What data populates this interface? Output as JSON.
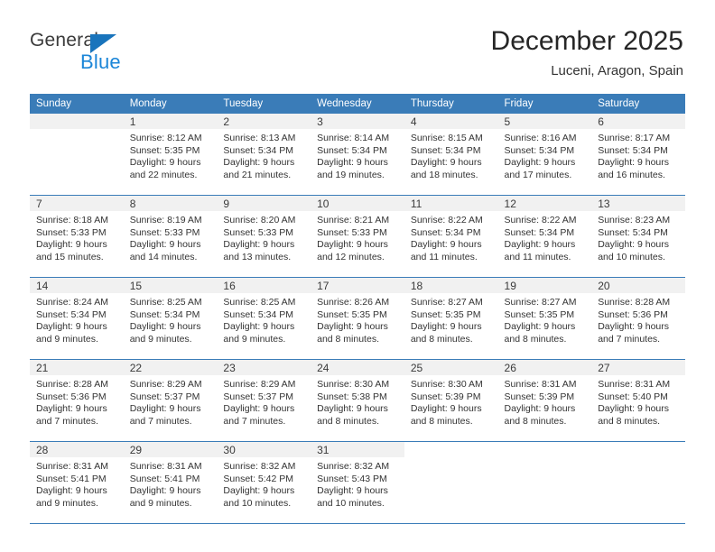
{
  "brand": {
    "name_part1": "General",
    "name_part2": "Blue",
    "triangle_color": "#1974bc",
    "blue_text_color": "#1b86d8"
  },
  "header": {
    "title": "December 2025",
    "location": "Luceni, Aragon, Spain"
  },
  "theme": {
    "header_bar_color": "#3a7cb8",
    "daynum_strip_color": "#f1f1f1",
    "row_border_color": "#3a7cb8",
    "text_color": "#333333"
  },
  "weekday_headers": [
    "Sunday",
    "Monday",
    "Tuesday",
    "Wednesday",
    "Thursday",
    "Friday",
    "Saturday"
  ],
  "labels": {
    "sunrise_prefix": "Sunrise:",
    "sunset_prefix": "Sunset:",
    "daylight_prefix": "Daylight:"
  },
  "weeks": [
    [
      {
        "day": "",
        "empty": true
      },
      {
        "day": "1",
        "sunrise": "Sunrise: 8:12 AM",
        "sunset": "Sunset: 5:35 PM",
        "daylight_line1": "Daylight: 9 hours",
        "daylight_line2": "and 22 minutes."
      },
      {
        "day": "2",
        "sunrise": "Sunrise: 8:13 AM",
        "sunset": "Sunset: 5:34 PM",
        "daylight_line1": "Daylight: 9 hours",
        "daylight_line2": "and 21 minutes."
      },
      {
        "day": "3",
        "sunrise": "Sunrise: 8:14 AM",
        "sunset": "Sunset: 5:34 PM",
        "daylight_line1": "Daylight: 9 hours",
        "daylight_line2": "and 19 minutes."
      },
      {
        "day": "4",
        "sunrise": "Sunrise: 8:15 AM",
        "sunset": "Sunset: 5:34 PM",
        "daylight_line1": "Daylight: 9 hours",
        "daylight_line2": "and 18 minutes."
      },
      {
        "day": "5",
        "sunrise": "Sunrise: 8:16 AM",
        "sunset": "Sunset: 5:34 PM",
        "daylight_line1": "Daylight: 9 hours",
        "daylight_line2": "and 17 minutes."
      },
      {
        "day": "6",
        "sunrise": "Sunrise: 8:17 AM",
        "sunset": "Sunset: 5:34 PM",
        "daylight_line1": "Daylight: 9 hours",
        "daylight_line2": "and 16 minutes."
      }
    ],
    [
      {
        "day": "7",
        "sunrise": "Sunrise: 8:18 AM",
        "sunset": "Sunset: 5:33 PM",
        "daylight_line1": "Daylight: 9 hours",
        "daylight_line2": "and 15 minutes."
      },
      {
        "day": "8",
        "sunrise": "Sunrise: 8:19 AM",
        "sunset": "Sunset: 5:33 PM",
        "daylight_line1": "Daylight: 9 hours",
        "daylight_line2": "and 14 minutes."
      },
      {
        "day": "9",
        "sunrise": "Sunrise: 8:20 AM",
        "sunset": "Sunset: 5:33 PM",
        "daylight_line1": "Daylight: 9 hours",
        "daylight_line2": "and 13 minutes."
      },
      {
        "day": "10",
        "sunrise": "Sunrise: 8:21 AM",
        "sunset": "Sunset: 5:33 PM",
        "daylight_line1": "Daylight: 9 hours",
        "daylight_line2": "and 12 minutes."
      },
      {
        "day": "11",
        "sunrise": "Sunrise: 8:22 AM",
        "sunset": "Sunset: 5:34 PM",
        "daylight_line1": "Daylight: 9 hours",
        "daylight_line2": "and 11 minutes."
      },
      {
        "day": "12",
        "sunrise": "Sunrise: 8:22 AM",
        "sunset": "Sunset: 5:34 PM",
        "daylight_line1": "Daylight: 9 hours",
        "daylight_line2": "and 11 minutes."
      },
      {
        "day": "13",
        "sunrise": "Sunrise: 8:23 AM",
        "sunset": "Sunset: 5:34 PM",
        "daylight_line1": "Daylight: 9 hours",
        "daylight_line2": "and 10 minutes."
      }
    ],
    [
      {
        "day": "14",
        "sunrise": "Sunrise: 8:24 AM",
        "sunset": "Sunset: 5:34 PM",
        "daylight_line1": "Daylight: 9 hours",
        "daylight_line2": "and 9 minutes."
      },
      {
        "day": "15",
        "sunrise": "Sunrise: 8:25 AM",
        "sunset": "Sunset: 5:34 PM",
        "daylight_line1": "Daylight: 9 hours",
        "daylight_line2": "and 9 minutes."
      },
      {
        "day": "16",
        "sunrise": "Sunrise: 8:25 AM",
        "sunset": "Sunset: 5:34 PM",
        "daylight_line1": "Daylight: 9 hours",
        "daylight_line2": "and 9 minutes."
      },
      {
        "day": "17",
        "sunrise": "Sunrise: 8:26 AM",
        "sunset": "Sunset: 5:35 PM",
        "daylight_line1": "Daylight: 9 hours",
        "daylight_line2": "and 8 minutes."
      },
      {
        "day": "18",
        "sunrise": "Sunrise: 8:27 AM",
        "sunset": "Sunset: 5:35 PM",
        "daylight_line1": "Daylight: 9 hours",
        "daylight_line2": "and 8 minutes."
      },
      {
        "day": "19",
        "sunrise": "Sunrise: 8:27 AM",
        "sunset": "Sunset: 5:35 PM",
        "daylight_line1": "Daylight: 9 hours",
        "daylight_line2": "and 8 minutes."
      },
      {
        "day": "20",
        "sunrise": "Sunrise: 8:28 AM",
        "sunset": "Sunset: 5:36 PM",
        "daylight_line1": "Daylight: 9 hours",
        "daylight_line2": "and 7 minutes."
      }
    ],
    [
      {
        "day": "21",
        "sunrise": "Sunrise: 8:28 AM",
        "sunset": "Sunset: 5:36 PM",
        "daylight_line1": "Daylight: 9 hours",
        "daylight_line2": "and 7 minutes."
      },
      {
        "day": "22",
        "sunrise": "Sunrise: 8:29 AM",
        "sunset": "Sunset: 5:37 PM",
        "daylight_line1": "Daylight: 9 hours",
        "daylight_line2": "and 7 minutes."
      },
      {
        "day": "23",
        "sunrise": "Sunrise: 8:29 AM",
        "sunset": "Sunset: 5:37 PM",
        "daylight_line1": "Daylight: 9 hours",
        "daylight_line2": "and 7 minutes."
      },
      {
        "day": "24",
        "sunrise": "Sunrise: 8:30 AM",
        "sunset": "Sunset: 5:38 PM",
        "daylight_line1": "Daylight: 9 hours",
        "daylight_line2": "and 8 minutes."
      },
      {
        "day": "25",
        "sunrise": "Sunrise: 8:30 AM",
        "sunset": "Sunset: 5:39 PM",
        "daylight_line1": "Daylight: 9 hours",
        "daylight_line2": "and 8 minutes."
      },
      {
        "day": "26",
        "sunrise": "Sunrise: 8:31 AM",
        "sunset": "Sunset: 5:39 PM",
        "daylight_line1": "Daylight: 9 hours",
        "daylight_line2": "and 8 minutes."
      },
      {
        "day": "27",
        "sunrise": "Sunrise: 8:31 AM",
        "sunset": "Sunset: 5:40 PM",
        "daylight_line1": "Daylight: 9 hours",
        "daylight_line2": "and 8 minutes."
      }
    ],
    [
      {
        "day": "28",
        "sunrise": "Sunrise: 8:31 AM",
        "sunset": "Sunset: 5:41 PM",
        "daylight_line1": "Daylight: 9 hours",
        "daylight_line2": "and 9 minutes."
      },
      {
        "day": "29",
        "sunrise": "Sunrise: 8:31 AM",
        "sunset": "Sunset: 5:41 PM",
        "daylight_line1": "Daylight: 9 hours",
        "daylight_line2": "and 9 minutes."
      },
      {
        "day": "30",
        "sunrise": "Sunrise: 8:32 AM",
        "sunset": "Sunset: 5:42 PM",
        "daylight_line1": "Daylight: 9 hours",
        "daylight_line2": "and 10 minutes."
      },
      {
        "day": "31",
        "sunrise": "Sunrise: 8:32 AM",
        "sunset": "Sunset: 5:43 PM",
        "daylight_line1": "Daylight: 9 hours",
        "daylight_line2": "and 10 minutes."
      },
      {
        "day": "",
        "blank": true
      },
      {
        "day": "",
        "blank": true
      },
      {
        "day": "",
        "blank": true
      }
    ]
  ]
}
